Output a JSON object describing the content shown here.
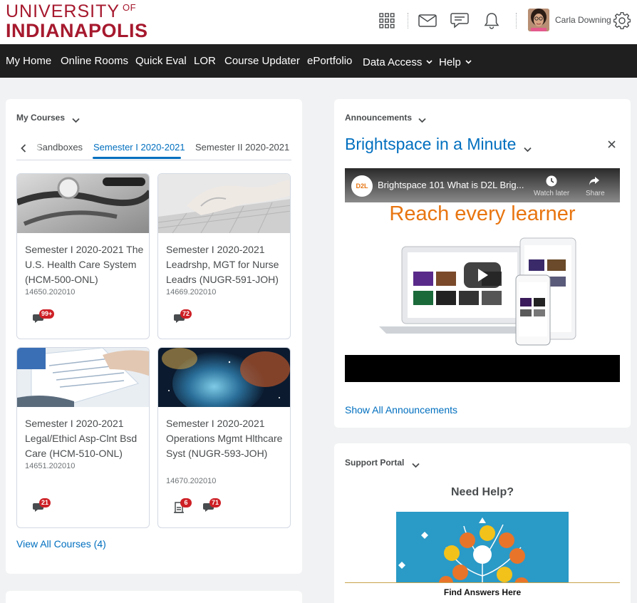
{
  "brand": {
    "line1": "UNIVERSITY",
    "of": "OF",
    "line2": "INDIANAPOLIS",
    "color": "#a6192e"
  },
  "header": {
    "icons": [
      "waffle-icon",
      "mail-icon",
      "chat-icon",
      "bell-icon",
      "gear-icon"
    ],
    "user_name": "Carla Downing"
  },
  "nav": {
    "items": [
      {
        "label": "My Home"
      },
      {
        "label": "Online Rooms"
      },
      {
        "label": "Quick Eval"
      },
      {
        "label": "LOR"
      },
      {
        "label": "Course Updater"
      },
      {
        "label": "ePortfolio"
      },
      {
        "label": "Data Access",
        "dropdown": true
      },
      {
        "label": "Help",
        "dropdown": true
      }
    ]
  },
  "my_courses": {
    "title": "My Courses",
    "tabs": [
      {
        "label": "Sandboxes"
      },
      {
        "label": "Semester I 2020-2021",
        "active": true
      },
      {
        "label": "Semester II 2020-2021"
      }
    ],
    "courses": [
      {
        "title": "Semester I 2020-2021 The U.S. Health Care System (HCM-500-ONL)",
        "code": "14650.202010",
        "discussion_badge": "99+"
      },
      {
        "title": "Semester I 2020-2021 Leadrshp, MGT for Nurse Leadrs (NUGR-591-JOH)",
        "code": "14669.202010",
        "discussion_badge": "72"
      },
      {
        "title": "Semester I 2020-2021 Legal/Ethicl Asp-Clnt Bsd Care (HCM-510-ONL)",
        "code": "14651.202010",
        "discussion_badge": "21"
      },
      {
        "title": "Semester I 2020-2021 Operations Mgmt Hlthcare Syst (NUGR-593-JOH)",
        "code": "14670.202010",
        "assignment_badge": "6",
        "discussion_badge": "71"
      }
    ],
    "view_all": "View All Courses (4)"
  },
  "announcements": {
    "title": "Announcements",
    "item_title": "Brightspace in a Minute",
    "video": {
      "logo": "D2L",
      "caption": "Brightspace 101 What is D2L Brig...",
      "watch_later": "Watch later",
      "share": "Share",
      "headline": "Reach every learner"
    },
    "show_all": "Show All Announcements"
  },
  "support": {
    "title": "Support Portal",
    "heading": "Need Help?",
    "button": "Find Answers Here"
  },
  "colors": {
    "link": "#006fbf",
    "badge": "#cd2026",
    "nav_bg": "#1f1f1f",
    "video_accent": "#e87511"
  }
}
